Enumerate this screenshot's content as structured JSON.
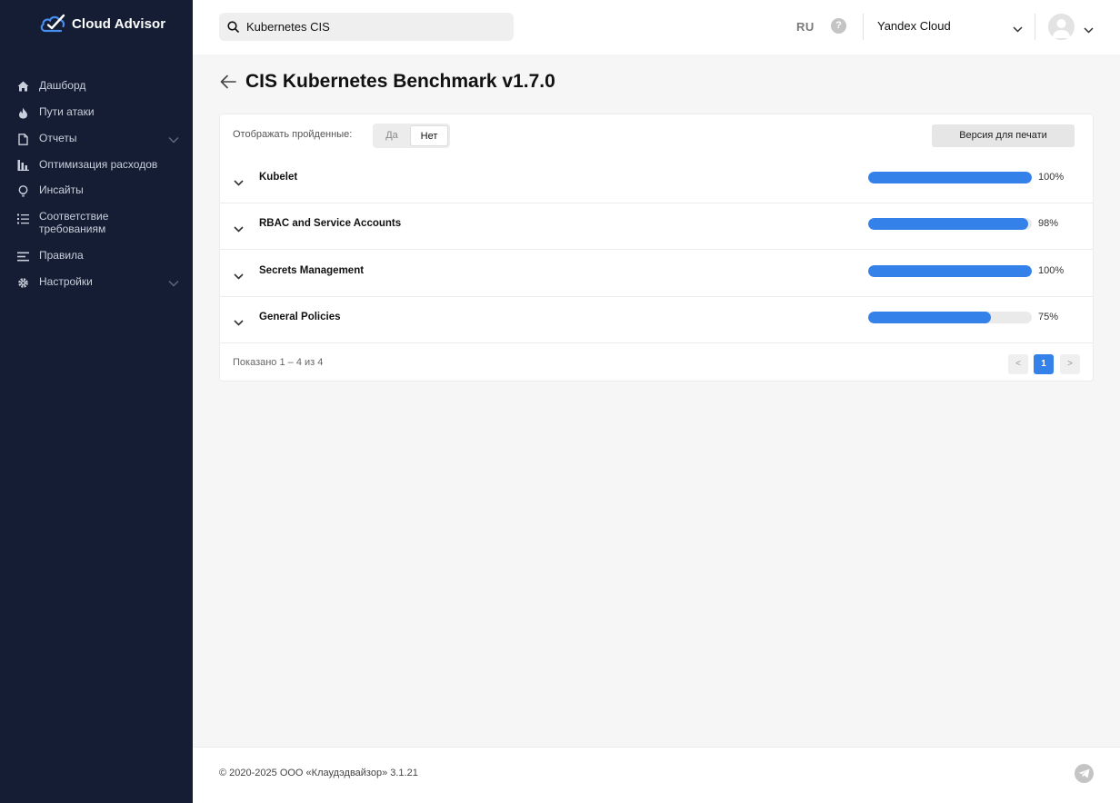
{
  "app": {
    "name": "Cloud Advisor"
  },
  "sidebar": {
    "items": [
      {
        "label": "Дашборд",
        "icon": "home-icon",
        "has_submenu": false
      },
      {
        "label": "Пути атаки",
        "icon": "flame-icon",
        "has_submenu": false
      },
      {
        "label": "Отчеты",
        "icon": "document-icon",
        "has_submenu": true
      },
      {
        "label": "Оптимизация расходов",
        "icon": "bar-chart-icon",
        "has_submenu": false
      },
      {
        "label": "Инсайты",
        "icon": "lightbulb-icon",
        "has_submenu": false
      },
      {
        "label": "Соответствие требованиям",
        "icon": "checklist-icon",
        "has_submenu": false
      },
      {
        "label": "Правила",
        "icon": "rules-icon",
        "has_submenu": false
      },
      {
        "label": "Настройки",
        "icon": "gear-icon",
        "has_submenu": true
      }
    ]
  },
  "topbar": {
    "search_value": "Kubernetes CIS",
    "language": "RU",
    "help": "?",
    "cloud": "Yandex Cloud"
  },
  "page": {
    "title": "CIS Kubernetes Benchmark v1.7.0"
  },
  "filter": {
    "label": "Отображать пройденные:",
    "yes": "Да",
    "no": "Нет",
    "selected": "Нет"
  },
  "print_button": "Версия для печати",
  "sections": [
    {
      "name": "Kubelet",
      "progress": 100,
      "progress_label": "100%"
    },
    {
      "name": "RBAC and Service Accounts",
      "progress": 98,
      "progress_label": "98%"
    },
    {
      "name": "Secrets Management",
      "progress": 100,
      "progress_label": "100%"
    },
    {
      "name": "General Policies",
      "progress": 75,
      "progress_label": "75%"
    }
  ],
  "pagination": {
    "info": "Показано 1 – 4 из 4",
    "prev": "<",
    "current": "1",
    "next": ">"
  },
  "footer": {
    "copyright": "© 2020-2025 ООО «Клаудэдвайзор» 3.1.21"
  },
  "colors": {
    "sidebar_bg": "#141d33",
    "accent": "#3481ea",
    "logo_accent": "#4a8df0"
  }
}
